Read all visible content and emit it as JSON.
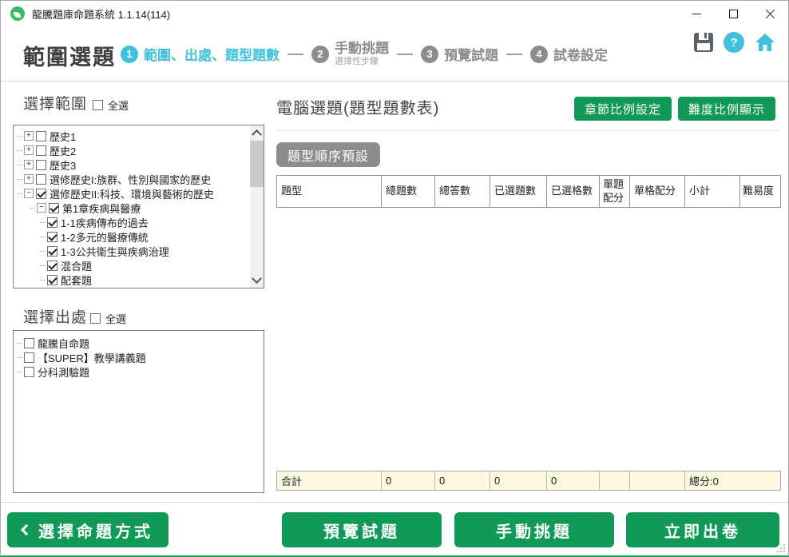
{
  "window": {
    "title": "龍騰題庫命題系統 1.1.14(114)"
  },
  "header": {
    "page_title": "範圍選題",
    "steps": [
      {
        "num": "1",
        "label": "範圍、出處、題型題數",
        "sublabel": "",
        "active": true
      },
      {
        "num": "2",
        "label": "手動挑題",
        "sublabel": "選擇性步驟",
        "active": false
      },
      {
        "num": "3",
        "label": "預覽試題",
        "sublabel": "",
        "active": false
      },
      {
        "num": "4",
        "label": "試卷設定",
        "sublabel": "",
        "active": false
      }
    ],
    "icons": {
      "help_glyph": "?"
    }
  },
  "scope": {
    "title": "選擇範圍",
    "select_all": "全選",
    "tree": [
      {
        "label": "歷史1",
        "exp": "+",
        "expcls": "has-exp",
        "lvl": "lvl0",
        "state": "unchecked"
      },
      {
        "label": "歷史2",
        "exp": "+",
        "expcls": "has-exp",
        "lvl": "lvl0",
        "state": "unchecked"
      },
      {
        "label": "歷史3",
        "exp": "+",
        "expcls": "has-exp",
        "lvl": "lvl0",
        "state": "unchecked"
      },
      {
        "label": "選修歷史I:族群、性別與國家的歷史",
        "exp": "+",
        "expcls": "has-exp",
        "lvl": "lvl0",
        "state": "unchecked"
      },
      {
        "label": "選修歷史II:科技、環境與藝術的歷史",
        "exp": "−",
        "expcls": "has-exp",
        "lvl": "lvl0",
        "state": "checked"
      },
      {
        "label": "第1章疾病與醫療",
        "exp": "−",
        "expcls": "has-exp",
        "lvl": "lvl1",
        "state": "checked"
      },
      {
        "label": "1-1疾病傳布的過去",
        "exp": "",
        "expcls": "no-exp",
        "lvl": "lvl2",
        "state": "checked"
      },
      {
        "label": "1-2多元的醫療傳統",
        "exp": "",
        "expcls": "no-exp",
        "lvl": "lvl2",
        "state": "checked"
      },
      {
        "label": "1-3公共衛生與疾病治理",
        "exp": "",
        "expcls": "no-exp",
        "lvl": "lvl2",
        "state": "checked"
      },
      {
        "label": "混合題",
        "exp": "",
        "expcls": "no-exp",
        "lvl": "lvl2",
        "state": "checked"
      },
      {
        "label": "配套題",
        "exp": "",
        "expcls": "no-exp",
        "lvl": "lvl2",
        "state": "checked"
      }
    ]
  },
  "source": {
    "title": "選擇出處",
    "select_all": "全選",
    "items": [
      {
        "label": "龍騰自命題",
        "state": "unchecked"
      },
      {
        "label": "【SUPER】教學講義題",
        "state": "unchecked"
      },
      {
        "label": "分科測驗題",
        "state": "unchecked"
      }
    ]
  },
  "main": {
    "title": "電腦選題(題型題數表)",
    "chapter_ratio_button": "章節比例設定",
    "difficulty_ratio_button": "難度比例顯示",
    "order_preset_button": "題型順序預設",
    "table": {
      "headers": [
        "題型",
        "總題數",
        "總答數",
        "已選題數",
        "已選格數",
        "單題配分",
        "單格配分",
        "小計",
        "難易度"
      ],
      "total": [
        "合計",
        "0",
        "0",
        "0",
        "0",
        "",
        "",
        "總分:0"
      ]
    }
  },
  "footer": {
    "back": "選擇命題方式",
    "preview": "預覽試題",
    "manual": "手動挑題",
    "generate": "立即出卷"
  },
  "colors": {
    "accent_green": "#119a57",
    "accent_cyan": "#3fc0db",
    "step_gray": "#8c8c8c",
    "total_row_bg": "#fbf8df"
  }
}
